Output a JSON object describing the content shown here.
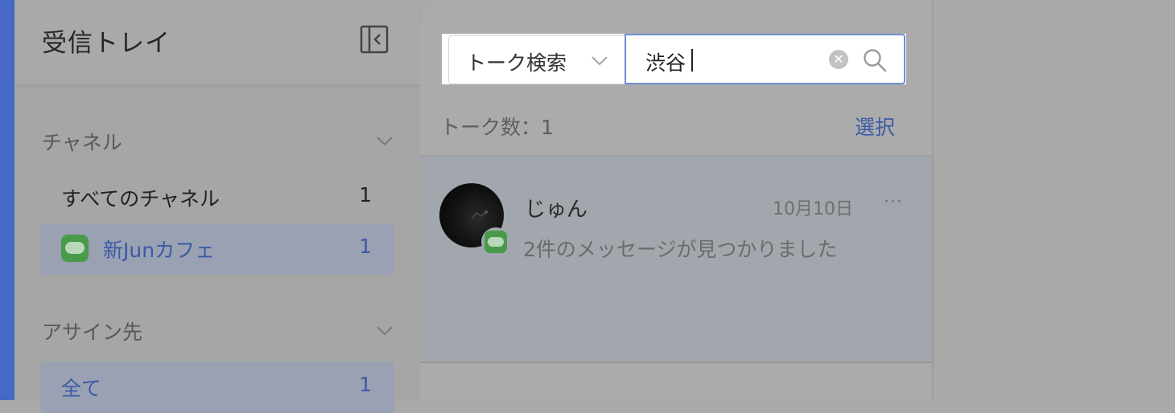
{
  "colors": {
    "accent": "#4569c4",
    "link": "#3b5aa7",
    "line_green": "#4a9a4b",
    "selected_bg": "#99a1b2",
    "focus_border": "#6e8ed8"
  },
  "sidebar": {
    "title": "受信トレイ",
    "collapse_icon": "sidebar-collapse-icon",
    "sections": [
      {
        "title": "チャネル",
        "items": [
          {
            "label": "すべてのチャネル",
            "count": "1",
            "selected": false
          },
          {
            "label": "新Junカフェ",
            "count": "1",
            "selected": true,
            "icon": "line-icon"
          }
        ]
      },
      {
        "title": "アサイン先",
        "items": [
          {
            "label": "全て",
            "count": "1",
            "selected": true
          }
        ]
      }
    ]
  },
  "search": {
    "type_label": "トーク検索",
    "query": "渋谷"
  },
  "talk_list": {
    "count_label": "トーク数：1",
    "select_label": "選択",
    "items": [
      {
        "name": "じゅん",
        "date": "10月10日",
        "more": "···",
        "preview": "2件のメッセージが見つかりました",
        "channel_icon": "line-icon"
      }
    ]
  }
}
